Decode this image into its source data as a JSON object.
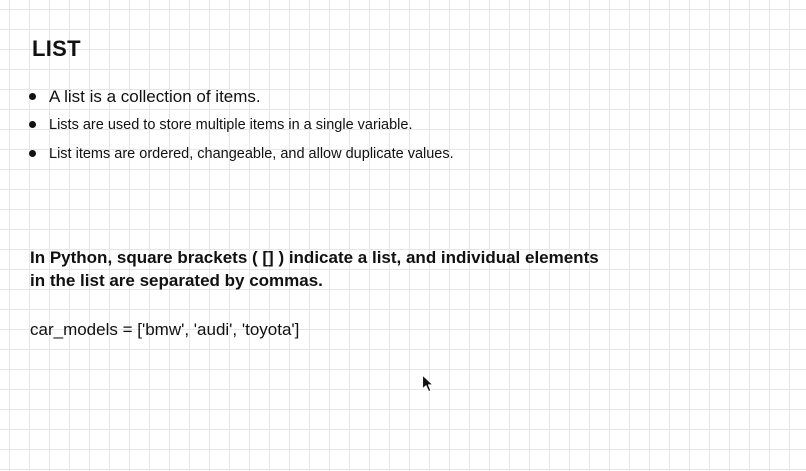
{
  "slide": {
    "title": "LIST",
    "bullets": [
      "A list is a collection of items.",
      "Lists are used to store multiple items in a single variable.",
      "List items are ordered, changeable, and allow duplicate values."
    ],
    "note_line1": "In Python, square brackets ( [] ) indicate a list, and individual elements",
    "note_line2": "in the list are separated by commas.",
    "code": "car_models = ['bmw', 'audi', 'toyota']"
  },
  "icons": {
    "cursor": "mouse-pointer-icon"
  },
  "colors": {
    "background": "#ffffff",
    "grid_line": "#e6e6e6",
    "text": "#111111"
  }
}
